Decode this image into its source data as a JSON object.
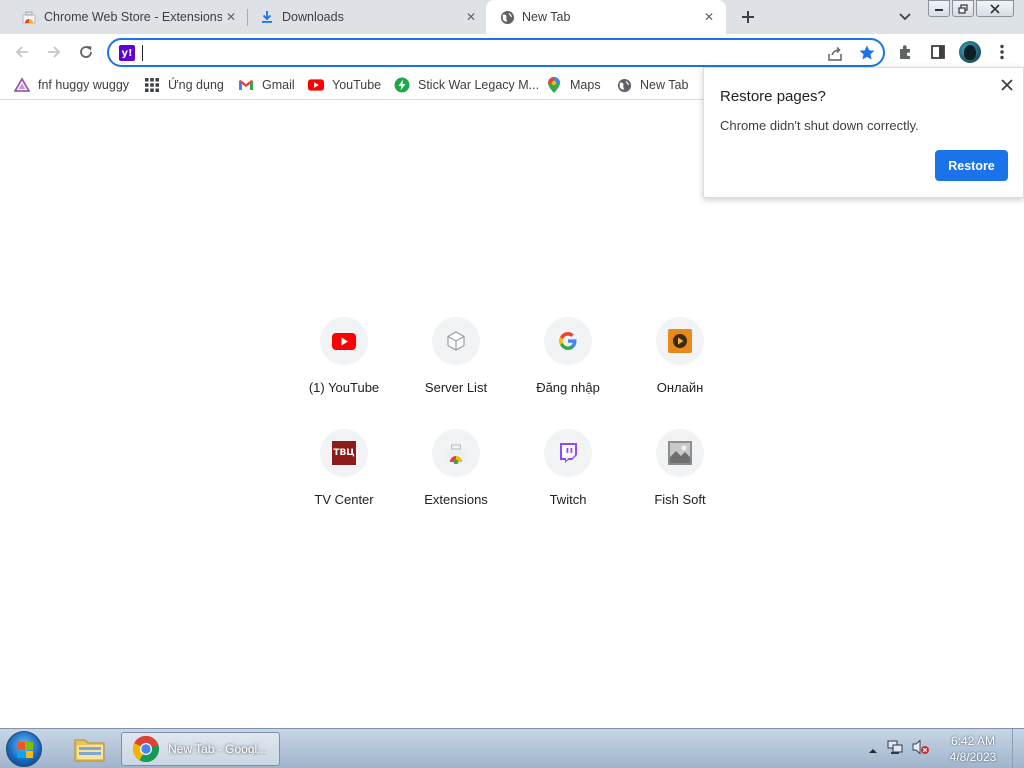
{
  "tabs": [
    {
      "title": "Chrome Web Store - Extensions",
      "icon": "webstore-icon"
    },
    {
      "title": "Downloads",
      "icon": "download-icon"
    },
    {
      "title": "New Tab",
      "icon": "globe-icon",
      "active": true
    }
  ],
  "omnibox": {
    "value": "",
    "search_engine": "yahoo-icon",
    "search_engine_glyph": "y!"
  },
  "bookmarks": [
    {
      "label": "fnf huggy wuggy",
      "icon": "triangle-icon"
    },
    {
      "label": "Ứng dụng",
      "icon": "apps-grid-icon"
    },
    {
      "label": "Gmail",
      "icon": "gmail-icon"
    },
    {
      "label": "YouTube",
      "icon": "youtube-icon"
    },
    {
      "label": "Stick War Legacy M...",
      "icon": "bolt-icon"
    },
    {
      "label": "Maps",
      "icon": "maps-pin-icon"
    },
    {
      "label": "New Tab",
      "icon": "globe-icon"
    }
  ],
  "restore_popup": {
    "title": "Restore pages?",
    "message": "Chrome didn't shut down correctly.",
    "button": "Restore"
  },
  "shortcuts": [
    {
      "label": "(1) YouTube",
      "icon": "youtube-icon"
    },
    {
      "label": "Server List",
      "icon": "box-icon"
    },
    {
      "label": "Đăng nhập",
      "icon": "google-icon"
    },
    {
      "label": "Онлайн",
      "icon": "play-icon"
    },
    {
      "label": "TV Center",
      "icon": "tvc-icon",
      "glyph": "ТВЦ"
    },
    {
      "label": "Extensions",
      "icon": "webstore-icon"
    },
    {
      "label": "Twitch",
      "icon": "twitch-icon"
    },
    {
      "label": "Fish Soft",
      "icon": "image-icon"
    }
  ],
  "taskbar": {
    "chrome_label": "New Tab - Googl...",
    "time": "6:42 AM",
    "date": "4/8/2023"
  },
  "colors": {
    "accent": "#1a73e8",
    "tabstrip": "#dee1e6"
  }
}
